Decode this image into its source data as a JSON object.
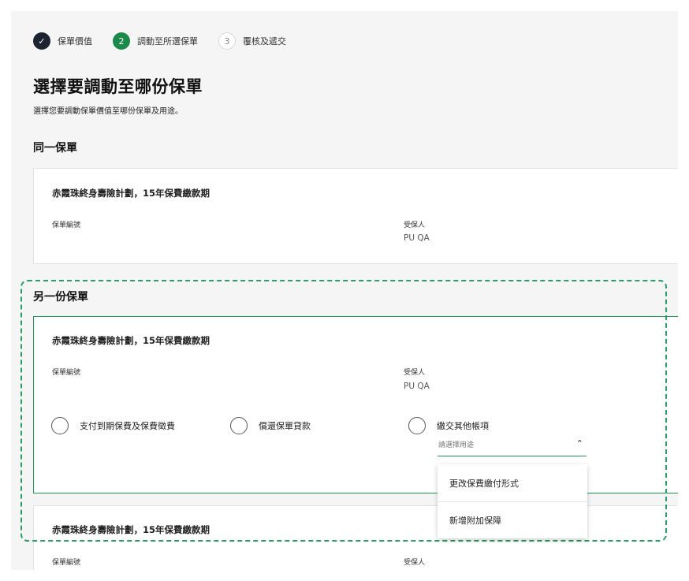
{
  "stepper": {
    "steps": [
      {
        "marker": "✓",
        "label": "保單價值"
      },
      {
        "marker": "2",
        "label": "調動至所選保單"
      },
      {
        "marker": "3",
        "label": "覆核及遞交"
      }
    ]
  },
  "page": {
    "title": "選擇要調動至哪份保單",
    "description": "選擇您要調動保單價值至哪份保單及用途。"
  },
  "same_policy": {
    "section_title": "同一保單",
    "card": {
      "plan": "赤霞珠終身壽險計劃，15年保費繳款期",
      "policy_no_label": "保單編號",
      "insured_label": "受保人",
      "insured_value": "PU QA"
    }
  },
  "other_policy": {
    "section_title": "另一份保單",
    "card": {
      "plan": "赤霞珠終身壽險計劃，15年保費繳款期",
      "policy_no_label": "保單編號",
      "insured_label": "受保人",
      "insured_value": "PU QA",
      "options": [
        {
          "label": "支付到期保費及保費徵費"
        },
        {
          "label": "償還保單貸款"
        },
        {
          "label": "繳交其他帳項"
        }
      ],
      "purpose_select": {
        "placeholder": "請選擇用途",
        "menu": [
          "更改保費繳付形式",
          "新增附加保障"
        ]
      }
    },
    "card2": {
      "plan": "赤霞珠終身壽險計劃，15年保費繳款期",
      "policy_no_label": "保單編號",
      "insured_label": "受保人"
    }
  },
  "colors": {
    "accent_green": "#1a8a4a",
    "done_step": "#1c2331",
    "page_bg": "#f5f5f5"
  }
}
